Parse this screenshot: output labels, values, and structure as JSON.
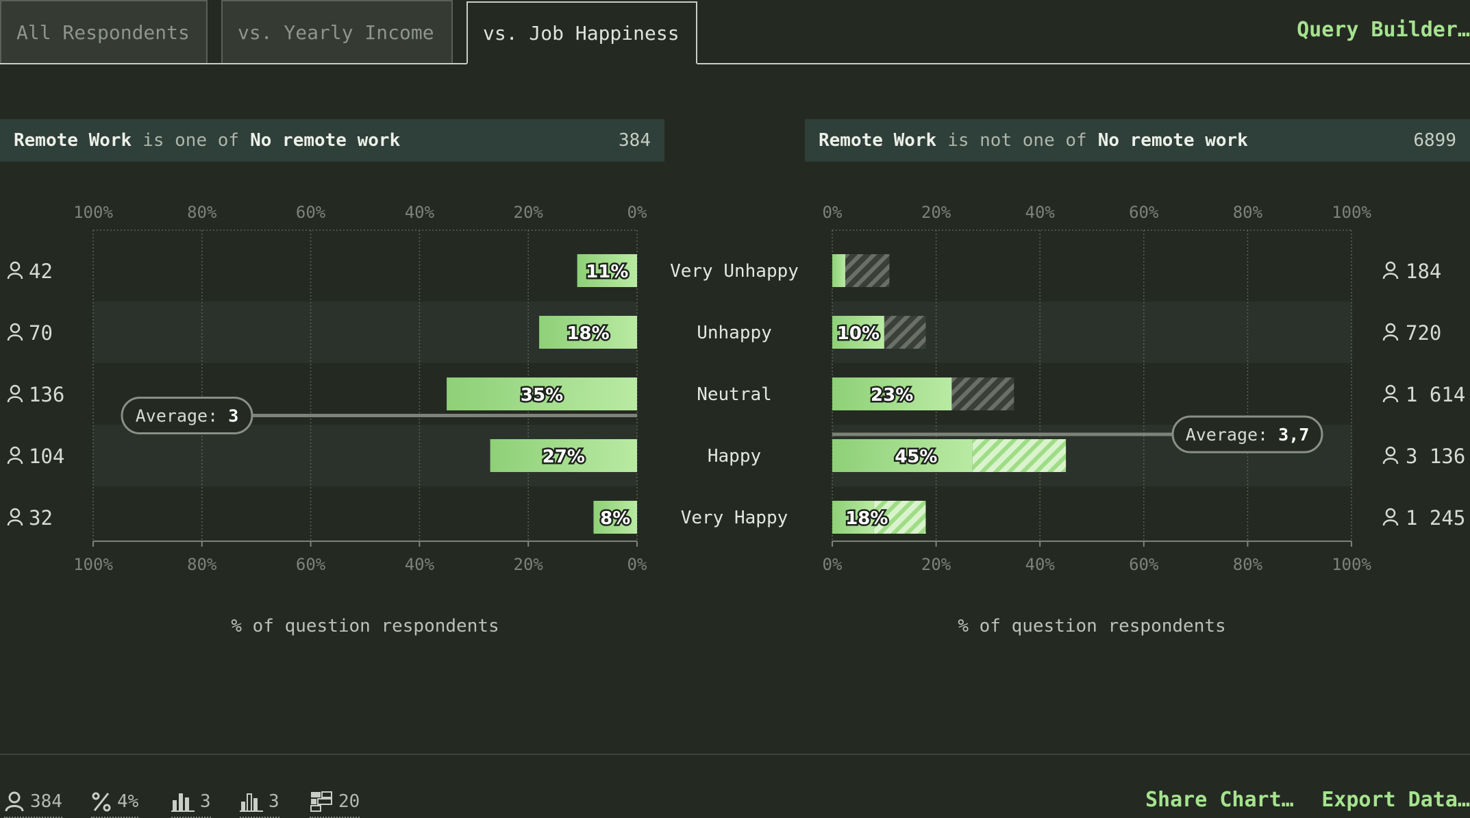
{
  "tabs": [
    {
      "label": "All Respondents",
      "active": false
    },
    {
      "label": "vs. Yearly Income",
      "active": false
    },
    {
      "label": "vs. Job Happiness",
      "active": true
    }
  ],
  "query_builder_label": "Query Builder…",
  "filters": {
    "left": {
      "field": "Remote Work",
      "op": "is one of",
      "value": "No remote work",
      "count": "384"
    },
    "right": {
      "field": "Remote Work",
      "op": "is not one of",
      "value": "No remote work",
      "count": "6899"
    }
  },
  "chart_data": [
    {
      "type": "bar",
      "orientation": "horizontal",
      "direction": "right-to-left",
      "categories": [
        "Very Unhappy",
        "Unhappy",
        "Neutral",
        "Happy",
        "Very Happy"
      ],
      "values": [
        11,
        18,
        35,
        27,
        8
      ],
      "value_labels": [
        "11%",
        "18%",
        "35%",
        "27%",
        "8%"
      ],
      "respondent_counts": [
        "42",
        "70",
        "136",
        "104",
        "32"
      ],
      "average_label": "Average:",
      "average": "3",
      "ticks": [
        "100%",
        "80%",
        "60%",
        "40%",
        "20%",
        "0%"
      ],
      "xlim": [
        0,
        100
      ],
      "xlabel": "% of question respondents"
    },
    {
      "type": "bar",
      "orientation": "horizontal",
      "direction": "left-to-right",
      "categories": [
        "Very Unhappy",
        "Unhappy",
        "Neutral",
        "Happy",
        "Very Happy"
      ],
      "values": [
        2.5,
        10,
        23,
        45,
        18
      ],
      "value_labels": [
        "",
        "10%",
        "23%",
        "45%",
        "18%"
      ],
      "comparison_values": [
        11,
        18,
        35,
        45,
        18
      ],
      "respondent_counts": [
        "184",
        "720",
        "1 614",
        "3 136",
        "1 245"
      ],
      "average_label": "Average:",
      "average": "3,7",
      "ticks": [
        "0%",
        "20%",
        "40%",
        "60%",
        "80%",
        "100%"
      ],
      "xlim": [
        0,
        100
      ],
      "xlabel": "% of question respondents"
    }
  ],
  "footer": {
    "stats": [
      {
        "icon": "person-icon",
        "value": "384"
      },
      {
        "icon": "percent-icon",
        "value": "4%"
      },
      {
        "icon": "bar-chart-icon",
        "value": "3"
      },
      {
        "icon": "bar-chart-outline-icon",
        "value": "3"
      },
      {
        "icon": "grid-icon",
        "value": "20"
      }
    ],
    "share_label": "Share Chart…",
    "export_label": "Export Data…"
  },
  "colors": {
    "accent": "#a6e38f",
    "bar_start": "#8ed077",
    "bar_end": "#b9eaa3",
    "background": "#242a22"
  }
}
